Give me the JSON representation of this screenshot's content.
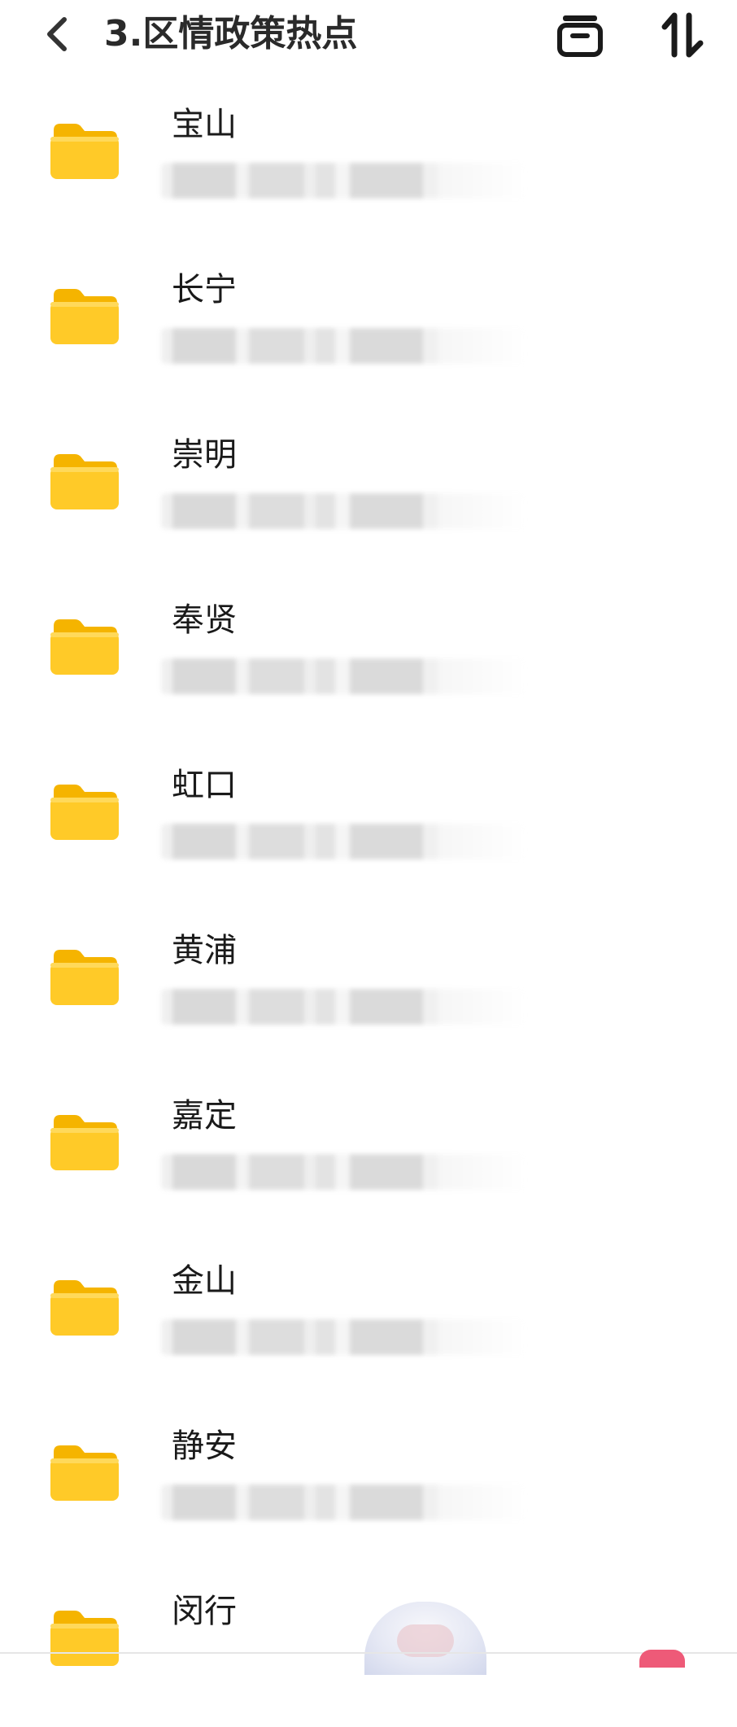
{
  "header": {
    "title": "3.区情政策热点",
    "back_icon": "chevron-left-icon",
    "archive_icon": "archive-box-icon",
    "sort_icon": "sort-arrows-icon"
  },
  "folders": [
    {
      "name": "宝山"
    },
    {
      "name": "长宁"
    },
    {
      "name": "崇明"
    },
    {
      "name": "奉贤"
    },
    {
      "name": "虹口"
    },
    {
      "name": "黄浦"
    },
    {
      "name": "嘉定"
    },
    {
      "name": "金山"
    },
    {
      "name": "静安"
    },
    {
      "name": "闵行"
    }
  ],
  "colors": {
    "folder_yellow": "#FFCA28",
    "folder_tab": "#F5B400",
    "title_text": "#2A2A2A",
    "accent_badge": "#EE5A78"
  }
}
